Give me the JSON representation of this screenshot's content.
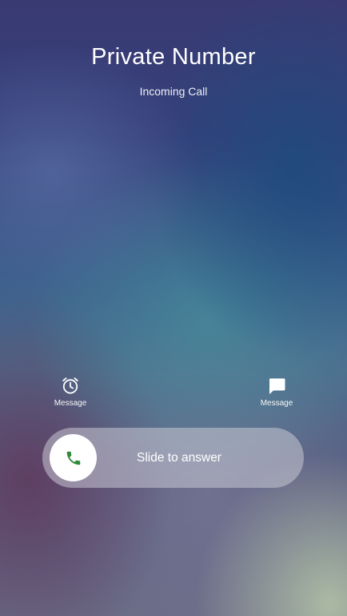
{
  "caller": {
    "name": "Private Number",
    "status": "Incoming Call"
  },
  "quick_actions": {
    "left": {
      "icon": "alarm-clock-icon",
      "label": "Message"
    },
    "right": {
      "icon": "message-bubble-icon",
      "label": "Message"
    }
  },
  "answer_slider": {
    "label": "Slide to answer",
    "icon": "phone-icon",
    "icon_color": "#2e8b3a"
  }
}
